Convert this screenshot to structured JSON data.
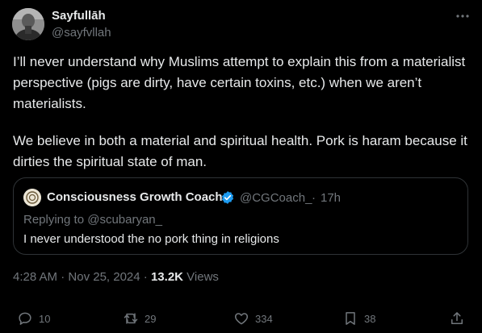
{
  "author": {
    "name": "Sayfullāh",
    "handle": "@sayfvllah"
  },
  "tweet": {
    "paragraphs": [
      "I’ll never understand why Muslims attempt to explain this from a materialist perspective (pigs are dirty, have certain toxins, etc.) when we aren’t materialists.",
      "We believe in both a material and spiritual health. Pork is haram because it dirties the spiritual state of man."
    ]
  },
  "quote": {
    "name": "Consciousness Growth Coach",
    "handle": "@CGCoach_",
    "separator": "·",
    "time": "17h",
    "reply_prefix": "Replying to",
    "reply_to": "@scubaryan_",
    "text": "I never understood the no pork thing in religions"
  },
  "meta": {
    "time": "4:28 AM",
    "separator": "·",
    "date": "Nov 25, 2024",
    "views_count": "13.2K",
    "views_label": "Views"
  },
  "actions": {
    "replies": "10",
    "reposts": "29",
    "likes": "334",
    "bookmarks": "38"
  },
  "icons": {
    "more": "more-horizontal-icon",
    "verified": "verified-badge-icon",
    "reply": "reply-icon",
    "repost": "repost-icon",
    "like": "heart-icon",
    "bookmark": "bookmark-icon",
    "share": "share-icon"
  },
  "colors": {
    "background": "#000000",
    "text": "#e7e9ea",
    "secondary_text": "#71767b",
    "border": "#2f3336",
    "verified": "#1d9bf0"
  }
}
